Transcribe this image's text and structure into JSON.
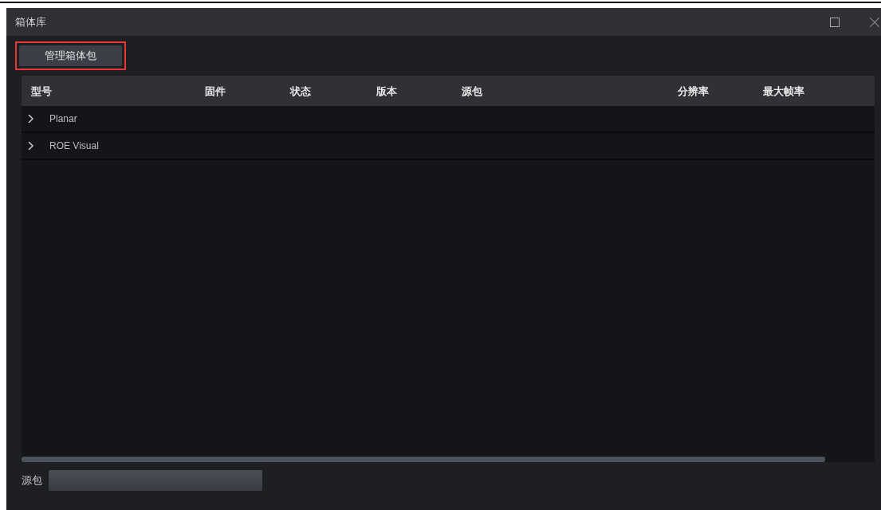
{
  "window": {
    "title": "箱体库"
  },
  "toolbar": {
    "button": {
      "label": "管理箱体包",
      "highlighted": true
    }
  },
  "table": {
    "columns": [
      "型号",
      "固件",
      "状态",
      "版本",
      "源包",
      "分辨率",
      "最大帧率"
    ],
    "rows": [
      {
        "name": "Planar",
        "expanded": false
      },
      {
        "name": "ROE Visual",
        "expanded": false
      }
    ]
  },
  "footer": {
    "label": "源包"
  }
}
